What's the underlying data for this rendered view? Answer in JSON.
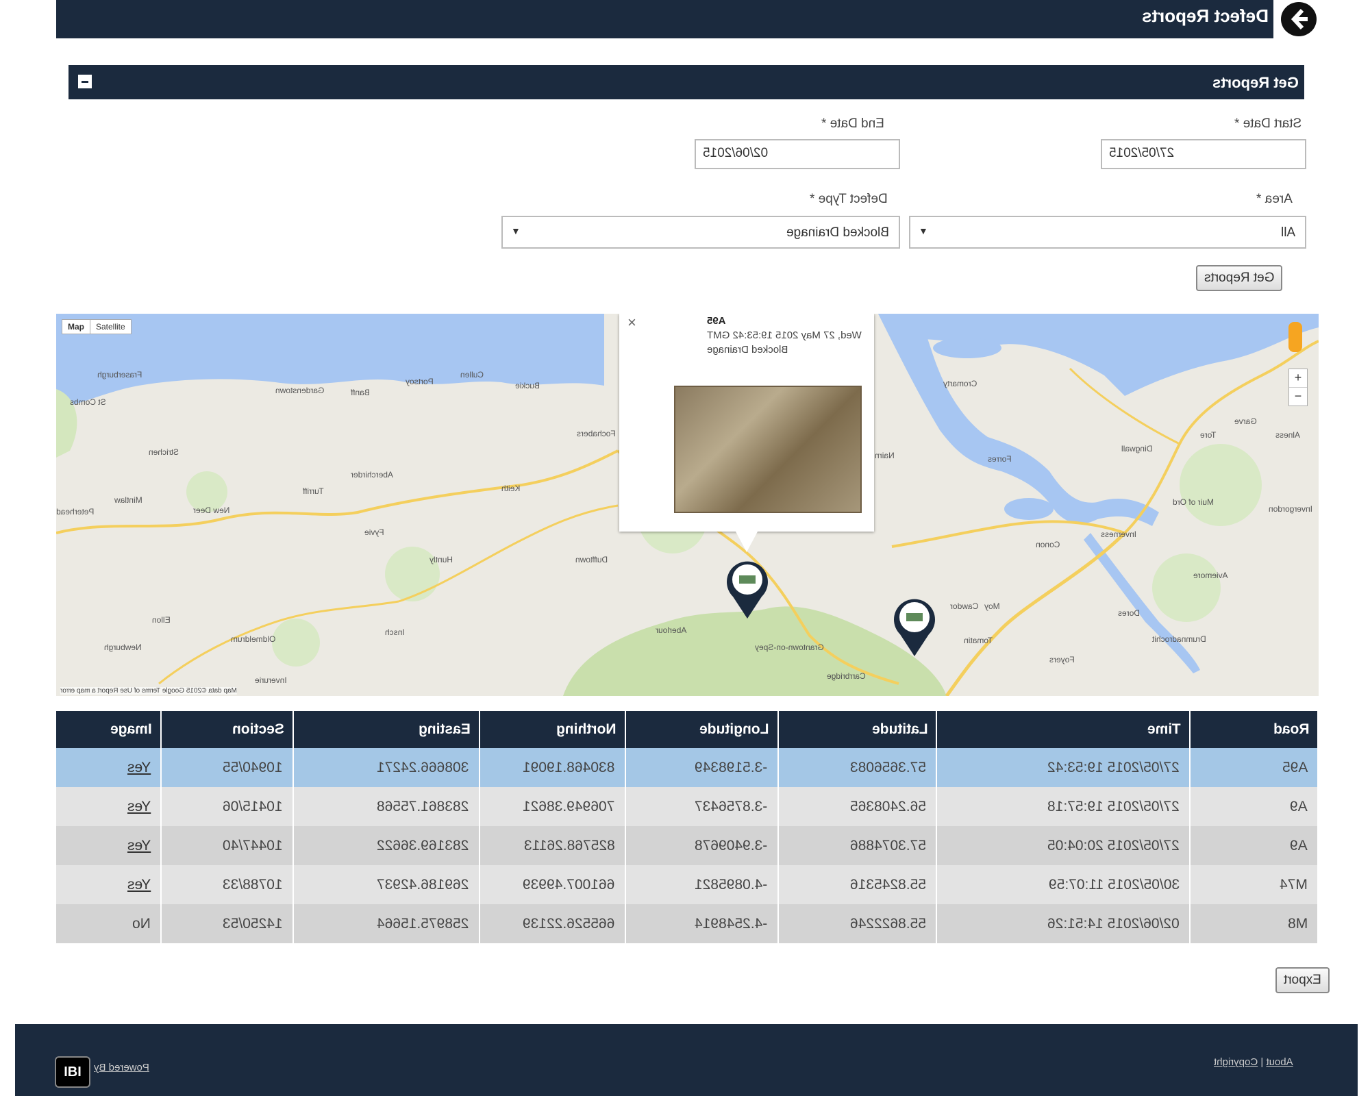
{
  "header": {
    "title": "Defect Reports",
    "back_icon": "arrow-left-circle-icon"
  },
  "panel": {
    "title": "Get Reports",
    "collapse_icon": "minus-icon",
    "start_date": {
      "label": "Start Date *",
      "value": "27/05/2015"
    },
    "end_date": {
      "label": "End Date *",
      "value": "02/06/2015"
    },
    "area": {
      "label": "Area *",
      "value": "All"
    },
    "defect_type": {
      "label": "Defect Type *",
      "value": "Blocked Drainage"
    },
    "submit_label": "Get Reports"
  },
  "map": {
    "type_buttons": [
      "Map",
      "Satellite"
    ],
    "towns": [
      "Fraserburgh",
      "St Combs",
      "Strichen",
      "Mintlaw",
      "Peterhead",
      "Ellon",
      "Newburgh",
      "Oldmeldrum",
      "Inverurie",
      "Insch",
      "Huntly",
      "Keith",
      "Turriff",
      "New Deer",
      "Fyvie",
      "Banff",
      "Portsoy",
      "Cullen",
      "Buckie",
      "Fochabers",
      "Aberchirder",
      "Gardenstown",
      "Dufftown",
      "Aberlour",
      "Grantown-on-Spey",
      "Carrbridge",
      "Tomatin",
      "Moy",
      "Inverness",
      "Nairn",
      "Forres",
      "Cromarty",
      "Dingwall",
      "Muir of Ord",
      "Aviemore",
      "Drumnadrochit",
      "Dores",
      "Foyers",
      "Alness",
      "Invergordon",
      "Conon",
      "Tore",
      "Garve",
      "Cawdor"
    ],
    "attribution": "Map data ©2015 Google   Terms of Use   Report a map error",
    "popup": {
      "road": "A95",
      "datetime": "Wed, 27 May 2015 19:53:42 GMT",
      "defect": "Blocked Drainage",
      "close": "×"
    },
    "zoom_in": "+",
    "zoom_out": "−"
  },
  "table": {
    "columns": [
      "Road",
      "Time",
      "Latitude",
      "Longitude",
      "Northing",
      "Easting",
      "Section",
      "Image"
    ],
    "rows": [
      [
        "A95",
        "27/05/2015 19:53:42",
        "57.3656083",
        "-3.5198349",
        "830468.19091",
        "308666.24271",
        "10940/55",
        "Yes"
      ],
      [
        "A9",
        "27/05/2015 19:57:18",
        "56.2408365",
        "-3.8756437",
        "706949.38621",
        "283861.75568",
        "10415/06",
        "Yes"
      ],
      [
        "A9",
        "27/05/2015 20:04:05",
        "57.3074886",
        "-3.9409678",
        "825768.26113",
        "283169.36622",
        "10447/40",
        "Yes"
      ],
      [
        "M74",
        "30/05/2015 11:07:59",
        "55.8245316",
        "-4.0895821",
        "661007.49939",
        "269186.42937",
        "10788/33",
        "Yes"
      ],
      [
        "M8",
        "02/06/2015 14:51:26",
        "55.8622246",
        "-4.2548914",
        "665526.22139",
        "258975.15664",
        "14250/53",
        "No"
      ]
    ]
  },
  "export_label": "Export",
  "footer": {
    "about": "About",
    "separator": "|",
    "copyright": "Copyright",
    "powered_by": "Powered By",
    "logo_text": "IBI"
  }
}
